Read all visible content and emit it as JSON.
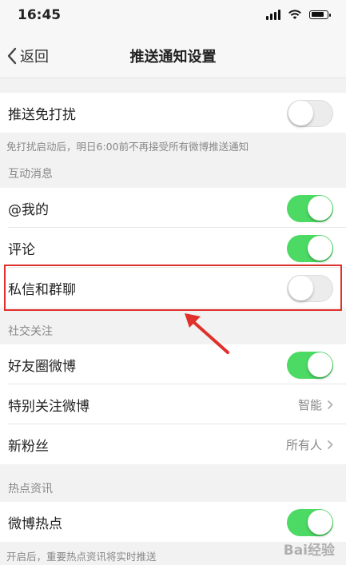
{
  "status_bar": {
    "time": "16:45"
  },
  "nav": {
    "back_label": "返回",
    "title": "推送通知设置"
  },
  "dnd": {
    "label": "推送免打扰",
    "enabled": false,
    "note": "免打扰启动后，明日6:00前不再接受所有微博推送通知"
  },
  "interaction": {
    "section_title": "互动消息",
    "items": [
      {
        "label": "@我的",
        "enabled": true
      },
      {
        "label": "评论",
        "enabled": true
      },
      {
        "label": "私信和群聊",
        "enabled": false
      }
    ]
  },
  "social": {
    "section_title": "社交关注",
    "friends_circle": {
      "label": "好友圈微博",
      "enabled": true
    },
    "special_follow": {
      "label": "特别关注微博",
      "value": "智能"
    },
    "new_fans": {
      "label": "新粉丝",
      "value": "所有人"
    }
  },
  "hot": {
    "section_title": "热点资讯",
    "items": [
      {
        "label": "微博热点",
        "enabled": true
      }
    ],
    "note": "开启后，重要热点资讯将实时推送"
  },
  "watermark": "Bai经验",
  "colors": {
    "toggle_on": "#4cd964",
    "toggle_off": "#ececec",
    "highlight": "#e0302b"
  }
}
